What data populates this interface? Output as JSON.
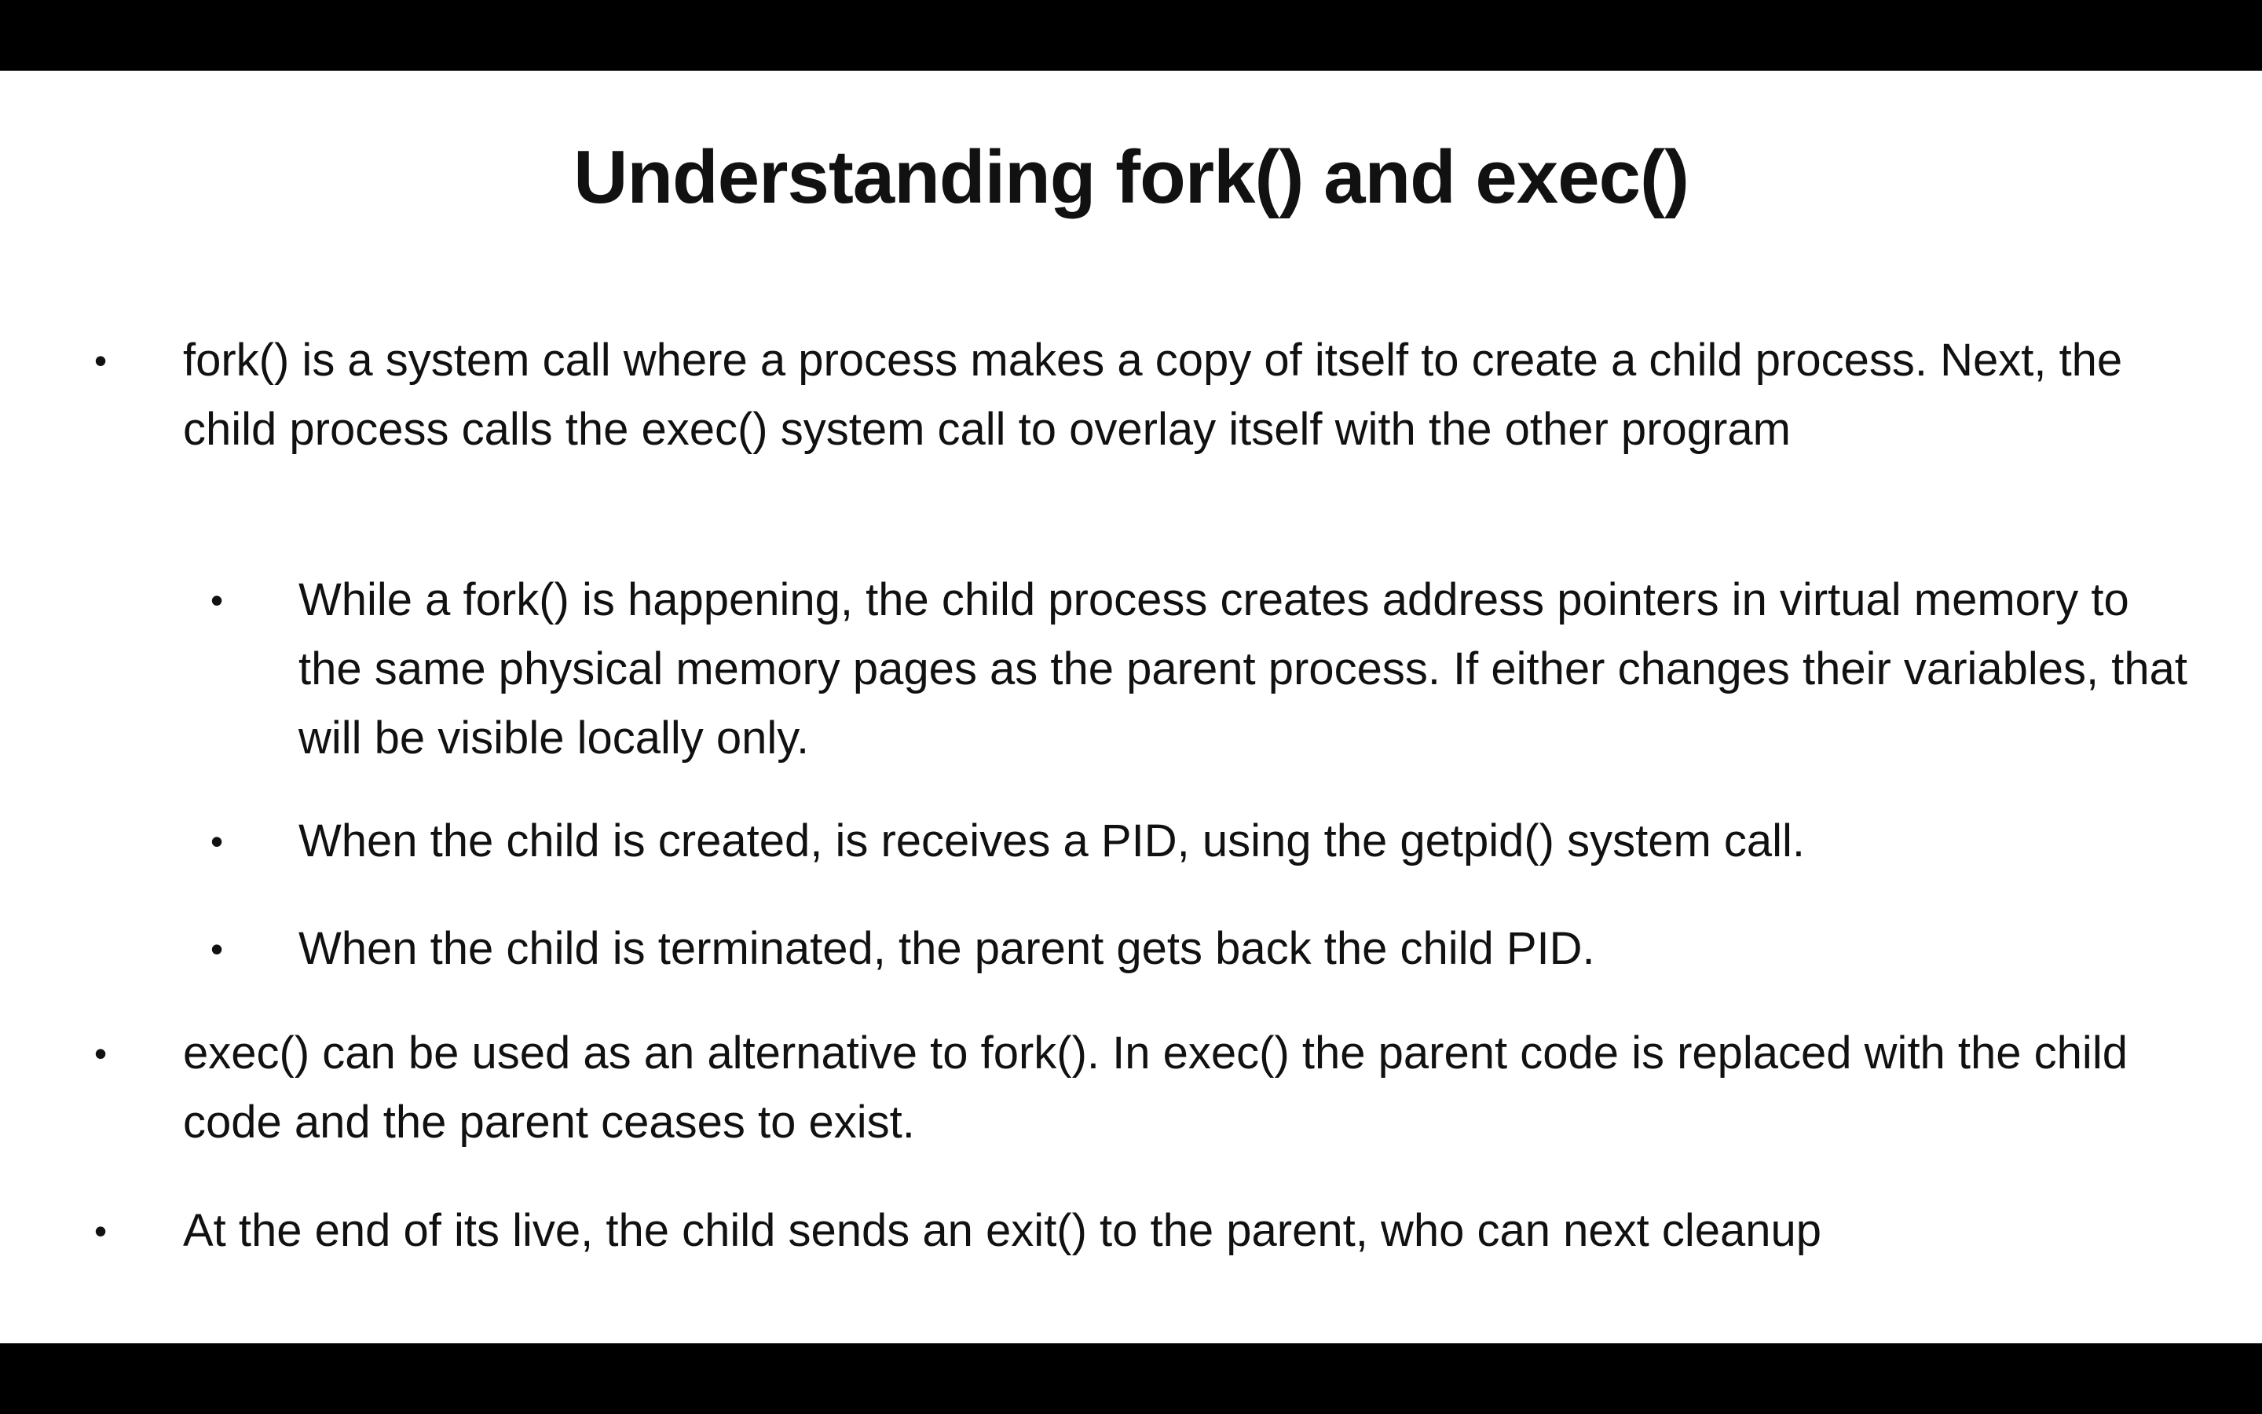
{
  "slide": {
    "title": "Understanding fork() and exec()",
    "bullets": [
      {
        "level": 1,
        "marker": "•",
        "text": "fork() is a system call where a process makes a copy of itself to create a child process. Next, the child process calls the exec() system call to overlay itself with the other program"
      },
      {
        "level": 2,
        "marker": "•",
        "text": "While a fork() is happening, the child process creates address pointers in virtual memory to the same physical memory pages as the parent process. If either changes their variables, that will be visible locally only."
      },
      {
        "level": 2,
        "marker": "•",
        "text": "When the child is created, is receives a PID, using the getpid() system call."
      },
      {
        "level": 2,
        "marker": "•",
        "text": "When the child is terminated, the parent gets back the child PID."
      },
      {
        "level": 1,
        "marker": "•",
        "text": "exec() can be used as an alternative to fork(). In exec() the parent code is replaced with the child code and the parent ceases to exist."
      },
      {
        "level": 1,
        "marker": "•",
        "text": "At the end of its live, the child sends an exit() to the parent, who can next cleanup"
      }
    ]
  },
  "colors": {
    "background": "#ffffff",
    "text": "#111111",
    "letterbox": "#000000"
  }
}
